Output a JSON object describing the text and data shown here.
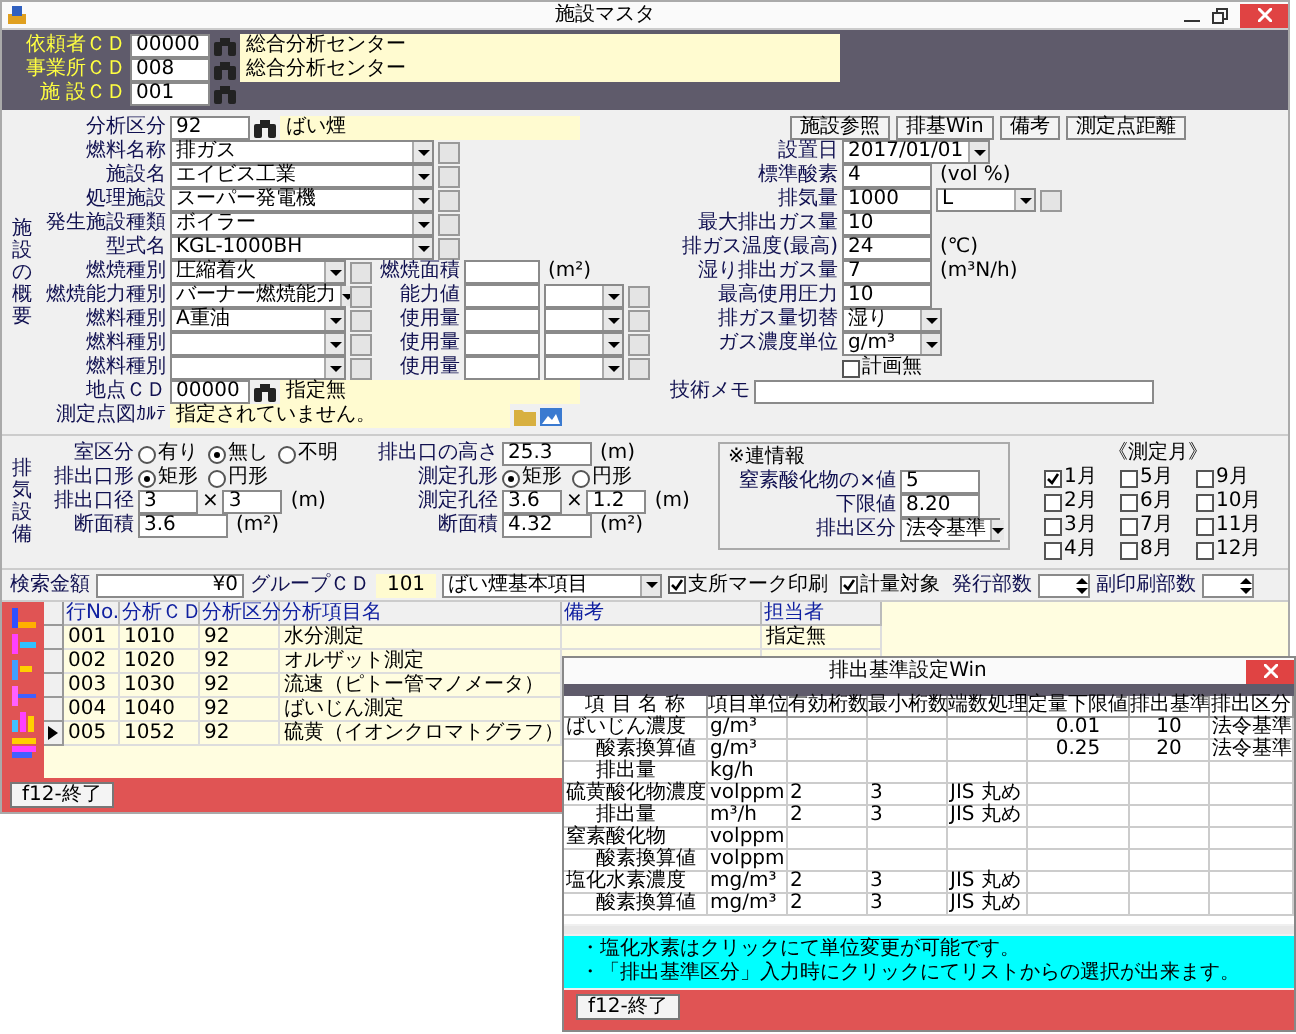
{
  "window": {
    "title": "施設マスタ"
  },
  "header": [
    {
      "label": "依頼者ＣＤ",
      "code": "00000",
      "name": "総合分析センター"
    },
    {
      "label": "事業所ＣＤ",
      "code": "008",
      "name": "総合分析センター"
    },
    {
      "label": "施 設ＣＤ",
      "code": "001"
    }
  ],
  "overview": {
    "section_label": "施設の概要",
    "left": [
      {
        "kind": "lookup",
        "label": "分析区分",
        "code": "92",
        "name": "ばい煙"
      },
      {
        "kind": "combo",
        "label": "燃料名称",
        "value": "排ガス"
      },
      {
        "kind": "combo",
        "label": "施設名",
        "value": "エイビス工業"
      },
      {
        "kind": "combo",
        "label": "処理施設",
        "value": "スーパー発電機"
      },
      {
        "kind": "combo",
        "label": "発生施設種類",
        "value": "ボイラー"
      },
      {
        "kind": "combo",
        "label": "型式名",
        "value": "KGL-1000BH"
      },
      {
        "kind": "pair",
        "label": "燃焼種別",
        "value": "圧縮着火",
        "mid_label": "燃焼面積",
        "unit": "(m²)"
      },
      {
        "kind": "pair",
        "label": "燃焼能力種別",
        "value": "バーナー燃焼能力",
        "mid_label": "能力値"
      },
      {
        "kind": "pair",
        "label": "燃料種別",
        "value": "A重油",
        "mid_label": "使用量"
      },
      {
        "kind": "pair",
        "label": "燃料種別",
        "mid_label": "使用量"
      },
      {
        "kind": "pair",
        "label": "燃料種別",
        "mid_label": "使用量"
      },
      {
        "kind": "lookup",
        "label": "地点ＣＤ",
        "code": "00000",
        "name": "指定無"
      },
      {
        "kind": "note",
        "label": "測定点図ｶﾙﾃ",
        "value": "指定されていません。"
      }
    ],
    "right": {
      "buttons": [
        "施設参照",
        "排基Win",
        "備考",
        "測定点距離"
      ],
      "fields": [
        {
          "kind": "date",
          "label": "設置日",
          "value": "2017/01/01"
        },
        {
          "kind": "text",
          "label": "標準酸素",
          "value": "4",
          "unit": "(vol %)"
        },
        {
          "kind": "combo_text",
          "label": "排気量",
          "value": "1000",
          "option": "L"
        },
        {
          "kind": "text",
          "label": "最大排出ガス量",
          "value": "10"
        },
        {
          "kind": "text",
          "label": "排ガス温度(最高)",
          "value": "24",
          "unit": "(℃)"
        },
        {
          "kind": "text",
          "label": "湿り排出ガス量",
          "value": "7",
          "unit": "(m³N/h)"
        },
        {
          "kind": "text",
          "label": "最高使用圧力",
          "value": "10"
        },
        {
          "kind": "combo",
          "label": "排ガス量切替",
          "value": "湿り"
        },
        {
          "kind": "combo",
          "label": "ガス濃度単位",
          "value": "g/m³"
        },
        {
          "kind": "checkbox",
          "label": "計画無",
          "checked": false
        }
      ],
      "memo": {
        "label": "技術メモ"
      }
    }
  },
  "exhaust": {
    "section_label": "排気設備",
    "left": [
      {
        "kind": "radio",
        "label": "室区分",
        "options": [
          {
            "label": "有り",
            "selected": false
          },
          {
            "label": "無し",
            "selected": true
          },
          {
            "label": "不明",
            "selected": false
          }
        ]
      },
      {
        "kind": "radio",
        "label": "排出口形",
        "options": [
          {
            "label": "矩形",
            "selected": true
          },
          {
            "label": "円形",
            "selected": false
          }
        ]
      },
      {
        "kind": "size",
        "label": "排出口径",
        "value": "3",
        "separator": "×",
        "value2": "3",
        "unit": "(m)"
      },
      {
        "kind": "text",
        "label": "断面積",
        "value": "3.6",
        "unit": "(m²)"
      }
    ],
    "right": [
      {
        "kind": "text",
        "label": "排出口の高さ",
        "value": "25.3",
        "unit": "(m)"
      },
      {
        "kind": "radio",
        "label": "測定孔形",
        "options": [
          {
            "label": "矩形",
            "selected": true
          },
          {
            "label": "円形",
            "selected": false
          }
        ]
      },
      {
        "kind": "size",
        "label": "測定孔径",
        "value": "3.6",
        "separator": "×",
        "value2": "1.2",
        "unit": "(m)"
      },
      {
        "kind": "text",
        "label": "断面積",
        "value": "4.32",
        "unit": "(m²)"
      }
    ],
    "linked": {
      "title": "※連情報",
      "fields": [
        {
          "kind": "text",
          "label": "窒素酸化物の×値",
          "value": "5"
        },
        {
          "kind": "text",
          "label": "下限値",
          "value": "8.20"
        },
        {
          "kind": "combo",
          "label": "排出区分",
          "value": "法令基準"
        }
      ]
    },
    "months": {
      "title": "《測定月》",
      "items": [
        {
          "label": "1月",
          "checked": true
        },
        {
          "label": "2月",
          "checked": false
        },
        {
          "label": "3月",
          "checked": false
        },
        {
          "label": "4月",
          "checked": false
        },
        {
          "label": "5月",
          "checked": false
        },
        {
          "label": "6月",
          "checked": false
        },
        {
          "label": "7月",
          "checked": false
        },
        {
          "label": "8月",
          "checked": false
        },
        {
          "label": "9月",
          "checked": false
        },
        {
          "label": "10月",
          "checked": false
        },
        {
          "label": "11月",
          "checked": false
        },
        {
          "label": "12月",
          "checked": false
        }
      ]
    }
  },
  "search": {
    "amount": {
      "label": "検索金額",
      "value": "¥0"
    },
    "group": {
      "label": "グループＣＤ",
      "code": "101",
      "value": "ばい煙基本項目"
    },
    "checks": [
      {
        "label": "支所マーク印刷",
        "checked": true
      },
      {
        "label": "計量対象",
        "checked": true
      }
    ],
    "spinners": [
      {
        "label": "発行部数"
      },
      {
        "label": "副印刷部数"
      }
    ]
  },
  "list": {
    "columns": [
      "行No.",
      "分析ＣＤ",
      "分析区分",
      "分析項目名",
      "備考",
      "担当者"
    ],
    "rows": [
      {
        "no": "001",
        "code": "1010",
        "category": "92",
        "item": "水分測定",
        "person": "指定無",
        "current": false
      },
      {
        "no": "002",
        "code": "1020",
        "category": "92",
        "item": "オルザット測定",
        "current": false
      },
      {
        "no": "003",
        "code": "1030",
        "category": "92",
        "item": "流速（ピトー管マノメータ）",
        "current": false
      },
      {
        "no": "004",
        "code": "1040",
        "category": "92",
        "item": "ばいじん測定",
        "current": false
      },
      {
        "no": "005",
        "code": "1052",
        "category": "92",
        "item": "硫黄（イオンクロマトグラフ）",
        "current": true
      }
    ]
  },
  "footer": {
    "button": "f12-終了"
  },
  "dialog": {
    "title": "排出基準設定Win",
    "columns": [
      "項 目 名 称",
      "項目単位",
      "有効桁数",
      "最小桁数",
      "端数処理",
      "定量下限値",
      "排出基準",
      "排出区分"
    ],
    "rows": [
      {
        "name": "ばいじん濃度",
        "unit": "g/m³",
        "lower_limit": "0.01",
        "standard": "10",
        "category": "法令基準",
        "children": [
          {
            "name": "酸素換算値",
            "unit": "g/m³",
            "lower_limit": "0.25",
            "standard": "20",
            "category": "法令基準"
          },
          {
            "name": "排出量",
            "unit": "kg/h"
          }
        ]
      },
      {
        "name": "硫黄酸化物濃度",
        "unit": "volppm",
        "digits": "2",
        "min_digits": "3",
        "rounding": "JIS 丸め",
        "children": [
          {
            "name": "排出量",
            "unit": "m³/h",
            "digits": "2",
            "min_digits": "3",
            "rounding": "JIS 丸め"
          }
        ]
      },
      {
        "name": "窒素酸化物",
        "unit": "volppm",
        "children": [
          {
            "name": "酸素換算値",
            "unit": "volppm"
          }
        ]
      },
      {
        "name": "塩化水素濃度",
        "unit": "mg/m³",
        "digits": "2",
        "min_digits": "3",
        "rounding": "JIS 丸め",
        "children": [
          {
            "name": "酸素換算値",
            "unit": "mg/m³",
            "digits": "2",
            "min_digits": "3",
            "rounding": "JIS 丸め"
          }
        ]
      }
    ],
    "notes": [
      "・塩化水素はクリックにて単位変更が可能です。",
      "・「排出基準区分」入力時にクリックにてリストからの選択が出来ます。"
    ],
    "button": "f12-終了"
  }
}
